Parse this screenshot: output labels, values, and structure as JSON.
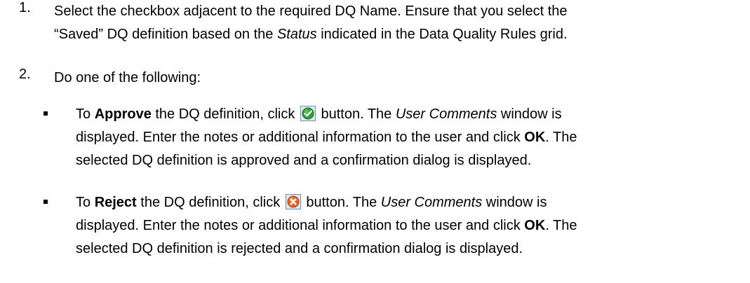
{
  "steps": [
    {
      "number": "1.",
      "lines": [
        {
          "t1": "Select the checkbox adjacent to the required DQ Name. Ensure that you select the"
        },
        {
          "t1": "“Saved” DQ definition based on the ",
          "i1": "Status",
          "t2": " indicated in the Data Quality Rules grid."
        }
      ]
    },
    {
      "number": "2.",
      "text": "Do one of the following:"
    }
  ],
  "bullets": [
    {
      "line1": {
        "t1": "To ",
        "b1": "Approve",
        "t2": " the DQ definition, click ",
        "icon": "approve-check-icon",
        "t3": " button. The ",
        "i1": "User Comments",
        "t4": " window is"
      },
      "line2": {
        "t1": "displayed. Enter the notes or additional information to the user and click ",
        "b1": "OK",
        "t2": ". The"
      },
      "line3": {
        "t1": "selected DQ definition is approved and a confirmation dialog is displayed."
      }
    },
    {
      "line1": {
        "t1": "To ",
        "b1": "Reject",
        "t2": " the DQ definition, click ",
        "icon": "reject-x-icon",
        "t3": " button. The ",
        "i1": "User Comments",
        "t4": " window is"
      },
      "line2": {
        "t1": "displayed. Enter the notes or additional information to the user and click ",
        "b1": "OK",
        "t2": ". The"
      },
      "line3": {
        "t1": "selected DQ definition is rejected and a confirmation dialog is displayed."
      }
    }
  ],
  "colors": {
    "approve_green": "#2e9e2e",
    "reject_orange": "#e8641e",
    "icon_frame": "#6f8fb8"
  }
}
